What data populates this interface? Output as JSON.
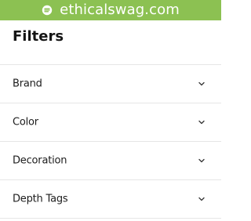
{
  "banner": {
    "site": "ethicalswag.com",
    "logo_icon": "ethicalswag-logo-icon",
    "background_color": "#8cc152"
  },
  "filters": {
    "title": "Filters",
    "sections": [
      {
        "label": "Brand",
        "icon": "chevron-down-icon"
      },
      {
        "label": "Color",
        "icon": "chevron-down-icon"
      },
      {
        "label": "Decoration",
        "icon": "chevron-down-icon"
      },
      {
        "label": "Depth Tags",
        "icon": "chevron-down-icon"
      }
    ]
  }
}
